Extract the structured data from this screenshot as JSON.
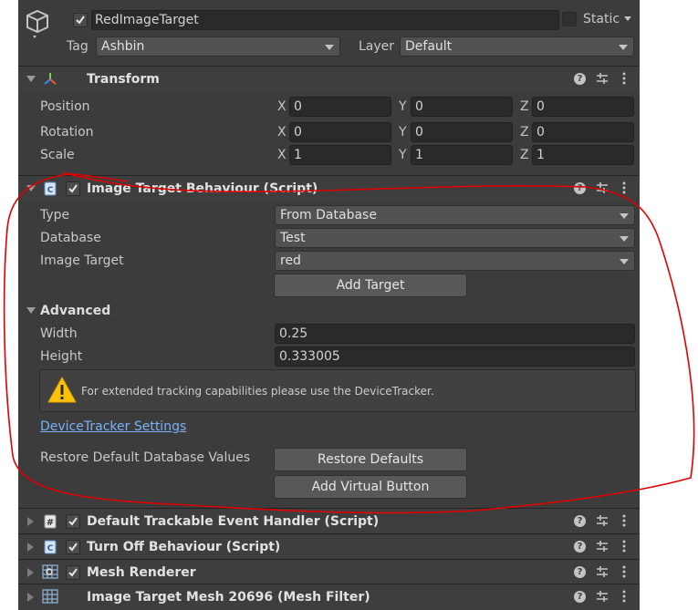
{
  "object": {
    "name": "RedImageTarget",
    "static_label": "Static",
    "tag_label": "Tag",
    "tag_value": "Ashbin",
    "layer_label": "Layer",
    "layer_value": "Default"
  },
  "transform": {
    "title": "Transform",
    "rows": [
      {
        "label": "Position",
        "x": "0",
        "y": "0",
        "z": "0"
      },
      {
        "label": "Rotation",
        "x": "0",
        "y": "0",
        "z": "0"
      },
      {
        "label": "Scale",
        "x": "1",
        "y": "1",
        "z": "1"
      }
    ],
    "axis_x": "X",
    "axis_y": "Y",
    "axis_z": "Z"
  },
  "image_target": {
    "title": "Image Target Behaviour (Script)",
    "type_label": "Type",
    "type_value": "From Database",
    "database_label": "Database",
    "database_value": "Test",
    "target_label": "Image Target",
    "target_value": "red",
    "add_target": "Add Target",
    "advanced_label": "Advanced",
    "width_label": "Width",
    "width_value": "0.25",
    "height_label": "Height",
    "height_value": "0.333005",
    "warning": "For extended tracking capabilities please use the DeviceTracker.",
    "link": "DeviceTracker Settings",
    "restore_label": "Restore Default Database Values",
    "restore_button": "Restore Defaults",
    "virtual_button": "Add Virtual Button"
  },
  "components": [
    {
      "title": "Default Trackable Event Handler (Script)",
      "icon": "hash-script-icon"
    },
    {
      "title": "Turn Off Behaviour (Script)",
      "icon": "script-icon"
    },
    {
      "title": "Mesh Renderer",
      "icon": "mesh-renderer-icon"
    },
    {
      "title": "Image Target Mesh 20696 (Mesh Filter)",
      "icon": "mesh-filter-icon"
    }
  ],
  "colors": {
    "panel": "#3c3c3c",
    "field": "#2a2a2a",
    "link": "#7bb2f7",
    "annotation": "#e00000",
    "warning": "#ffc107"
  }
}
